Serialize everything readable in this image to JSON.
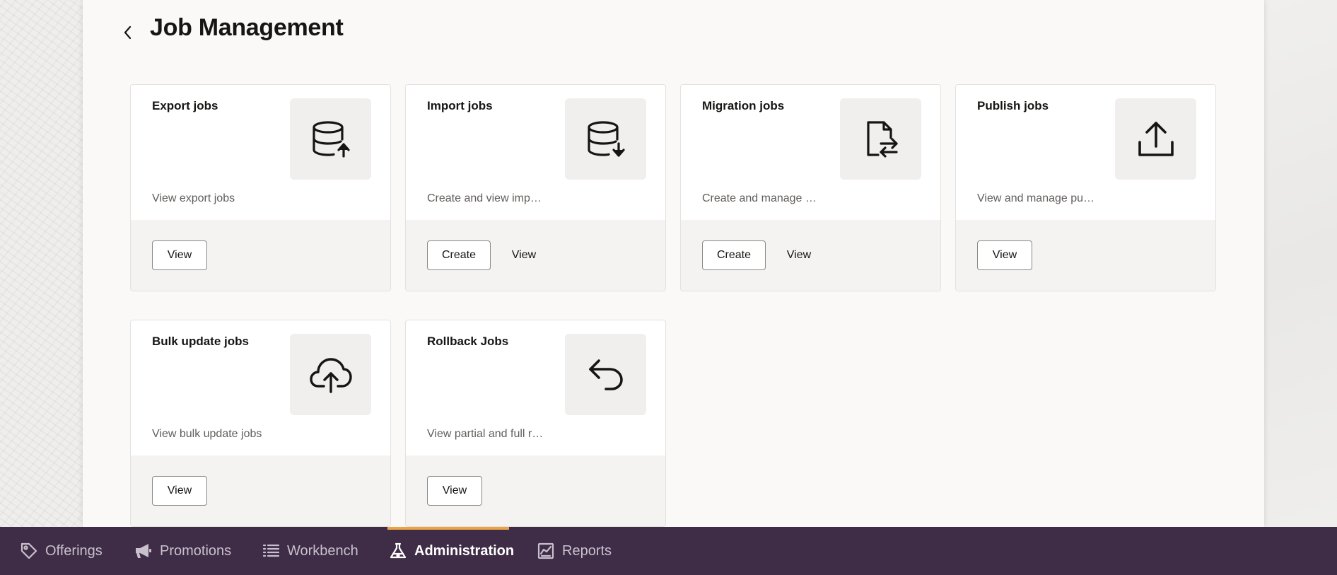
{
  "page": {
    "title": "Job Management"
  },
  "cards": [
    {
      "title": "Export jobs",
      "description": "View export jobs",
      "icon": "database-export-icon",
      "buttons": [
        "View"
      ]
    },
    {
      "title": "Import jobs",
      "description": "Create and view imp…",
      "icon": "database-import-icon",
      "buttons": [
        "Create",
        "View"
      ]
    },
    {
      "title": "Migration jobs",
      "description": "Create and manage …",
      "icon": "file-transfer-icon",
      "buttons": [
        "Create",
        "View"
      ]
    },
    {
      "title": "Publish jobs",
      "description": "View and manage pu…",
      "icon": "upload-icon",
      "buttons": [
        "View"
      ]
    },
    {
      "title": "Bulk update jobs",
      "description": "View bulk update jobs",
      "icon": "cloud-upload-icon",
      "buttons": [
        "View"
      ]
    },
    {
      "title": "Rollback Jobs",
      "description": "View partial and full r…",
      "icon": "undo-arrow-icon",
      "buttons": [
        "View"
      ]
    }
  ],
  "nav": {
    "items": [
      {
        "label": "Offerings",
        "icon": "tag-icon"
      },
      {
        "label": "Promotions",
        "icon": "megaphone-icon"
      },
      {
        "label": "Workbench",
        "icon": "list-icon"
      },
      {
        "label": "Administration",
        "icon": "lab-flask-icon",
        "active": true
      },
      {
        "label": "Reports",
        "icon": "report-chart-icon"
      }
    ],
    "active_color": "#e8a447",
    "background": "#3f2c47"
  }
}
